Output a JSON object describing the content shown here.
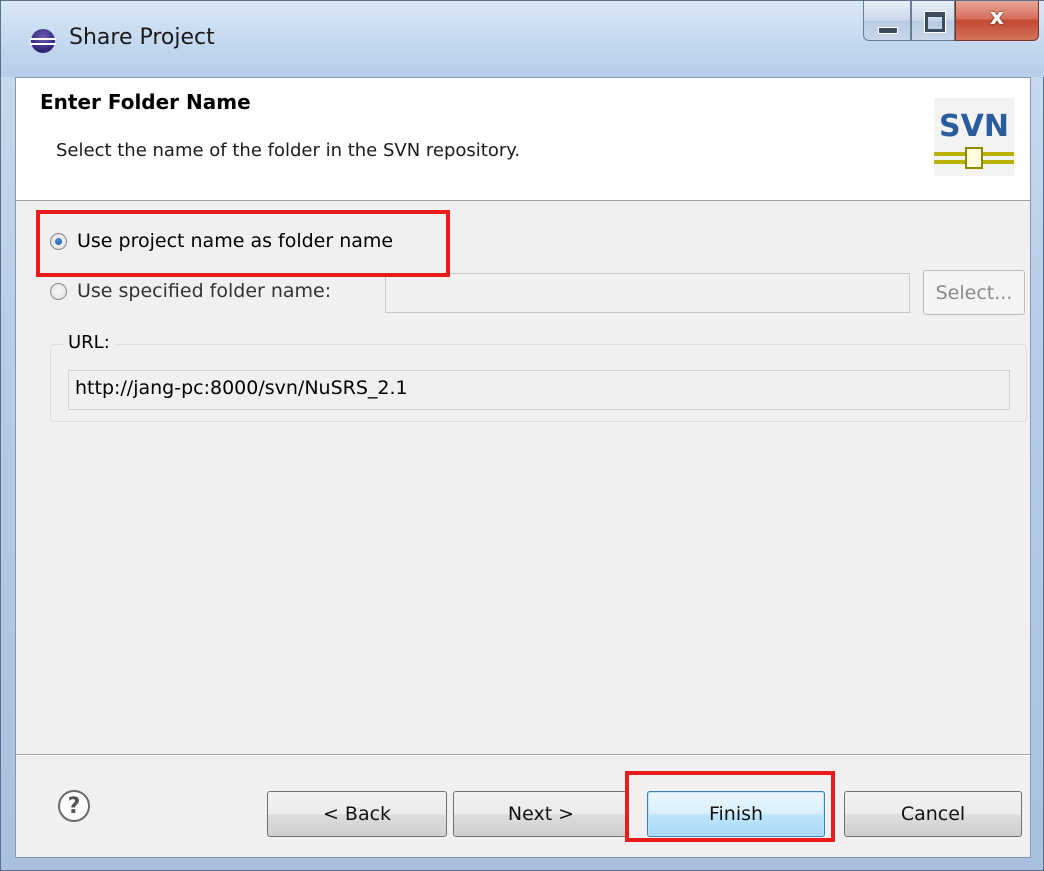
{
  "window": {
    "title": "Share Project"
  },
  "header": {
    "title": "Enter Folder Name",
    "description": "Select the name of the folder in the SVN repository.",
    "logo_text": "SVN"
  },
  "options": {
    "use_project_name_label": "Use project name as folder name",
    "use_project_name_checked": true,
    "use_specified_label": "Use specified folder name:",
    "use_specified_checked": false,
    "folder_name_value": "",
    "select_button_label": "Select..."
  },
  "url": {
    "label": "URL:",
    "value": "http://jang-pc:8000/svn/NuSRS_2.1"
  },
  "footer": {
    "help_glyph": "?",
    "back_label": "< Back",
    "next_label": "Next >",
    "finish_label": "Finish",
    "cancel_label": "Cancel"
  },
  "colors": {
    "highlight": "#e81c1c",
    "default_button_border": "#3c7fb1"
  }
}
